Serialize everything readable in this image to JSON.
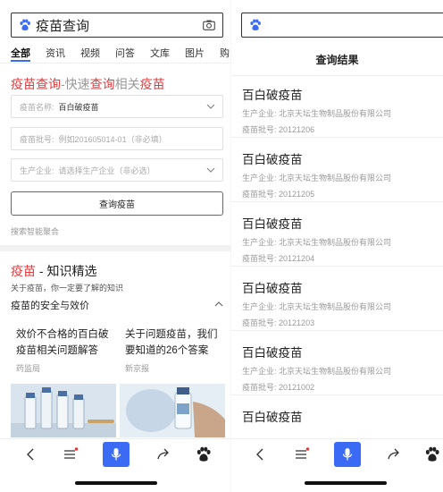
{
  "left": {
    "search": {
      "query": "疫苗查询"
    },
    "tabs": [
      "全部",
      "资讯",
      "视频",
      "问答",
      "文库",
      "图片",
      "购"
    ],
    "query_card": {
      "title_parts": [
        "疫苗查询",
        "-快速",
        "查询",
        "相关",
        "疫苗"
      ],
      "name_label": "疫苗名称:",
      "name_value": "百白破疫苗",
      "batch_label": "疫苗批号:",
      "batch_placeholder": "例如201605014-01（非必填）",
      "maker_label": "生产企业:",
      "maker_placeholder": "请选择生产企业（非必选）",
      "button": "查询疫苗",
      "footer": "搜索智能聚合"
    },
    "knowledge": {
      "title_red": "疫苗",
      "title_rest": " - 知识精选",
      "subtitle": "关于疫苗，你一定要了解的知识",
      "section": "疫苗的安全与效价",
      "cards": [
        {
          "title": "效价不合格的百白破疫苗相关问题解答",
          "source": "药监局"
        },
        {
          "title": "关于问题疫苗，我们要知道的26个答案",
          "source": "新京报"
        }
      ]
    }
  },
  "right": {
    "header": "查询结果",
    "results": [
      {
        "name": "百白破疫苗",
        "maker_label": "生产企业:",
        "maker": "北京天坛生物制品股份有限公司",
        "batch_label": "疫苗批号:",
        "batch": "20121206"
      },
      {
        "name": "百白破疫苗",
        "maker_label": "生产企业:",
        "maker": "北京天坛生物制品股份有限公司",
        "batch_label": "疫苗批号:",
        "batch": "20121205"
      },
      {
        "name": "百白破疫苗",
        "maker_label": "生产企业:",
        "maker": "北京天坛生物制品股份有限公司",
        "batch_label": "疫苗批号:",
        "batch": "20121204"
      },
      {
        "name": "百白破疫苗",
        "maker_label": "生产企业:",
        "maker": "北京天坛生物制品股份有限公司",
        "batch_label": "疫苗批号:",
        "batch": "20121203"
      },
      {
        "name": "百白破疫苗",
        "maker_label": "生产企业:",
        "maker": "北京天坛生物制品股份有限公司",
        "batch_label": "疫苗批号:",
        "batch": "20121002"
      },
      {
        "name": "百白破疫苗",
        "maker_label": "",
        "maker": "",
        "batch_label": "",
        "batch": ""
      }
    ]
  },
  "colors": {
    "accent": "#3b6af5",
    "brand_red": "#e4393c",
    "muted": "#999999"
  },
  "icons": [
    "paw-icon",
    "camera-icon",
    "chevron-down-icon",
    "chevron-up-icon",
    "back-icon",
    "menu-icon",
    "mic-icon",
    "share-icon"
  ]
}
